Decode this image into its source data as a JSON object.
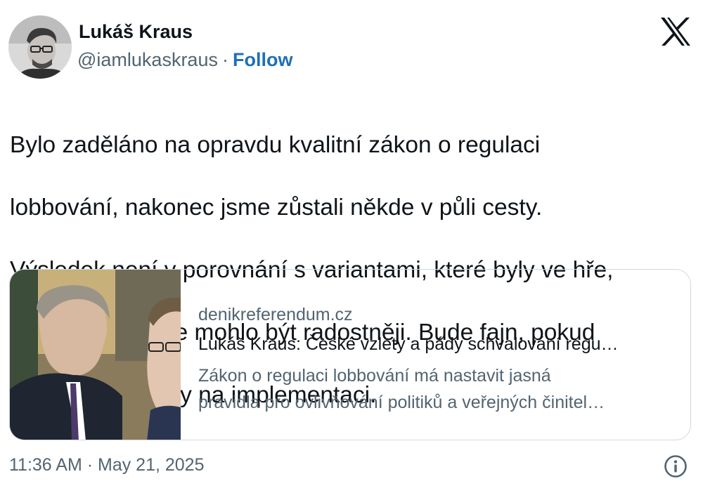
{
  "author": {
    "name": "Lukáš Kraus",
    "handle": "@iamlukaskraus",
    "separator": "·",
    "follow_label": "Follow"
  },
  "header": {
    "brand_icon": "x-logo-icon"
  },
  "tweet": {
    "lines": [
      "Bylo zaděláno na opravdu kvalitní zákon o regulaci",
      "lobbování, nakonec jsme zůstali někde v půli cesty.",
      "Výsledek není v porovnání s variantami, které byly ve hře,",
      "určitě špatný, ale mohlo být radostněji. Bude fajn, pokud",
      "vláda dá kapacity na implementaci."
    ]
  },
  "card": {
    "domain": "denikreferendum.cz",
    "title": "Lukáš Kraus: České vzlety a pády schvalování regu…",
    "description_lines": [
      "Zákon o regulaci lobbování má nastavit jasná",
      "pravidla pro ovlivňování politiků a veřejných činitel…"
    ],
    "image_icon": "article-photo"
  },
  "meta": {
    "timestamp": "11:36 AM · May 21, 2025",
    "info_icon": "info-icon"
  },
  "colors": {
    "text": "#0f1419",
    "secondary": "#536471",
    "link": "#1d70b8",
    "border": "#cfd9de"
  }
}
